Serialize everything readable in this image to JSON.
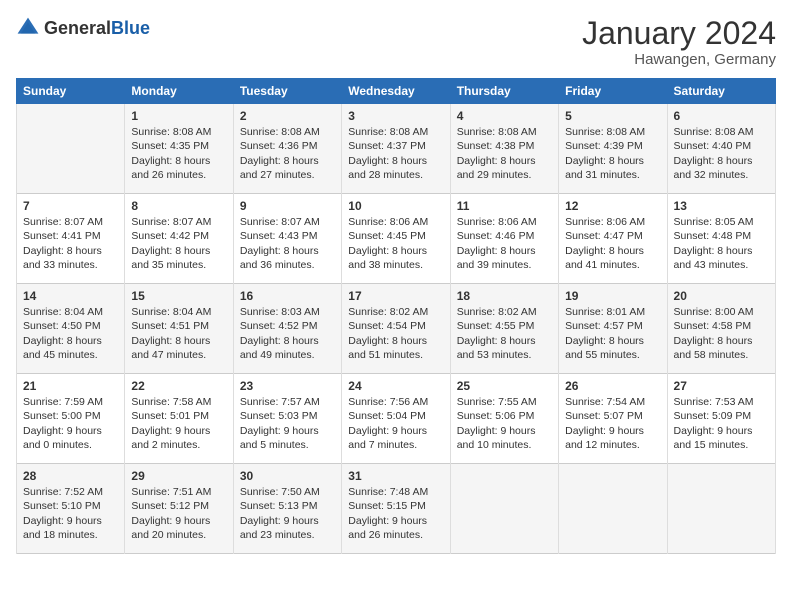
{
  "header": {
    "logo_general": "General",
    "logo_blue": "Blue",
    "month_title": "January 2024",
    "location": "Hawangen, Germany"
  },
  "weekdays": [
    "Sunday",
    "Monday",
    "Tuesday",
    "Wednesday",
    "Thursday",
    "Friday",
    "Saturday"
  ],
  "weeks": [
    [
      {
        "day": "",
        "lines": []
      },
      {
        "day": "1",
        "lines": [
          "Sunrise: 8:08 AM",
          "Sunset: 4:35 PM",
          "Daylight: 8 hours",
          "and 26 minutes."
        ]
      },
      {
        "day": "2",
        "lines": [
          "Sunrise: 8:08 AM",
          "Sunset: 4:36 PM",
          "Daylight: 8 hours",
          "and 27 minutes."
        ]
      },
      {
        "day": "3",
        "lines": [
          "Sunrise: 8:08 AM",
          "Sunset: 4:37 PM",
          "Daylight: 8 hours",
          "and 28 minutes."
        ]
      },
      {
        "day": "4",
        "lines": [
          "Sunrise: 8:08 AM",
          "Sunset: 4:38 PM",
          "Daylight: 8 hours",
          "and 29 minutes."
        ]
      },
      {
        "day": "5",
        "lines": [
          "Sunrise: 8:08 AM",
          "Sunset: 4:39 PM",
          "Daylight: 8 hours",
          "and 31 minutes."
        ]
      },
      {
        "day": "6",
        "lines": [
          "Sunrise: 8:08 AM",
          "Sunset: 4:40 PM",
          "Daylight: 8 hours",
          "and 32 minutes."
        ]
      }
    ],
    [
      {
        "day": "7",
        "lines": [
          "Sunrise: 8:07 AM",
          "Sunset: 4:41 PM",
          "Daylight: 8 hours",
          "and 33 minutes."
        ]
      },
      {
        "day": "8",
        "lines": [
          "Sunrise: 8:07 AM",
          "Sunset: 4:42 PM",
          "Daylight: 8 hours",
          "and 35 minutes."
        ]
      },
      {
        "day": "9",
        "lines": [
          "Sunrise: 8:07 AM",
          "Sunset: 4:43 PM",
          "Daylight: 8 hours",
          "and 36 minutes."
        ]
      },
      {
        "day": "10",
        "lines": [
          "Sunrise: 8:06 AM",
          "Sunset: 4:45 PM",
          "Daylight: 8 hours",
          "and 38 minutes."
        ]
      },
      {
        "day": "11",
        "lines": [
          "Sunrise: 8:06 AM",
          "Sunset: 4:46 PM",
          "Daylight: 8 hours",
          "and 39 minutes."
        ]
      },
      {
        "day": "12",
        "lines": [
          "Sunrise: 8:06 AM",
          "Sunset: 4:47 PM",
          "Daylight: 8 hours",
          "and 41 minutes."
        ]
      },
      {
        "day": "13",
        "lines": [
          "Sunrise: 8:05 AM",
          "Sunset: 4:48 PM",
          "Daylight: 8 hours",
          "and 43 minutes."
        ]
      }
    ],
    [
      {
        "day": "14",
        "lines": [
          "Sunrise: 8:04 AM",
          "Sunset: 4:50 PM",
          "Daylight: 8 hours",
          "and 45 minutes."
        ]
      },
      {
        "day": "15",
        "lines": [
          "Sunrise: 8:04 AM",
          "Sunset: 4:51 PM",
          "Daylight: 8 hours",
          "and 47 minutes."
        ]
      },
      {
        "day": "16",
        "lines": [
          "Sunrise: 8:03 AM",
          "Sunset: 4:52 PM",
          "Daylight: 8 hours",
          "and 49 minutes."
        ]
      },
      {
        "day": "17",
        "lines": [
          "Sunrise: 8:02 AM",
          "Sunset: 4:54 PM",
          "Daylight: 8 hours",
          "and 51 minutes."
        ]
      },
      {
        "day": "18",
        "lines": [
          "Sunrise: 8:02 AM",
          "Sunset: 4:55 PM",
          "Daylight: 8 hours",
          "and 53 minutes."
        ]
      },
      {
        "day": "19",
        "lines": [
          "Sunrise: 8:01 AM",
          "Sunset: 4:57 PM",
          "Daylight: 8 hours",
          "and 55 minutes."
        ]
      },
      {
        "day": "20",
        "lines": [
          "Sunrise: 8:00 AM",
          "Sunset: 4:58 PM",
          "Daylight: 8 hours",
          "and 58 minutes."
        ]
      }
    ],
    [
      {
        "day": "21",
        "lines": [
          "Sunrise: 7:59 AM",
          "Sunset: 5:00 PM",
          "Daylight: 9 hours",
          "and 0 minutes."
        ]
      },
      {
        "day": "22",
        "lines": [
          "Sunrise: 7:58 AM",
          "Sunset: 5:01 PM",
          "Daylight: 9 hours",
          "and 2 minutes."
        ]
      },
      {
        "day": "23",
        "lines": [
          "Sunrise: 7:57 AM",
          "Sunset: 5:03 PM",
          "Daylight: 9 hours",
          "and 5 minutes."
        ]
      },
      {
        "day": "24",
        "lines": [
          "Sunrise: 7:56 AM",
          "Sunset: 5:04 PM",
          "Daylight: 9 hours",
          "and 7 minutes."
        ]
      },
      {
        "day": "25",
        "lines": [
          "Sunrise: 7:55 AM",
          "Sunset: 5:06 PM",
          "Daylight: 9 hours",
          "and 10 minutes."
        ]
      },
      {
        "day": "26",
        "lines": [
          "Sunrise: 7:54 AM",
          "Sunset: 5:07 PM",
          "Daylight: 9 hours",
          "and 12 minutes."
        ]
      },
      {
        "day": "27",
        "lines": [
          "Sunrise: 7:53 AM",
          "Sunset: 5:09 PM",
          "Daylight: 9 hours",
          "and 15 minutes."
        ]
      }
    ],
    [
      {
        "day": "28",
        "lines": [
          "Sunrise: 7:52 AM",
          "Sunset: 5:10 PM",
          "Daylight: 9 hours",
          "and 18 minutes."
        ]
      },
      {
        "day": "29",
        "lines": [
          "Sunrise: 7:51 AM",
          "Sunset: 5:12 PM",
          "Daylight: 9 hours",
          "and 20 minutes."
        ]
      },
      {
        "day": "30",
        "lines": [
          "Sunrise: 7:50 AM",
          "Sunset: 5:13 PM",
          "Daylight: 9 hours",
          "and 23 minutes."
        ]
      },
      {
        "day": "31",
        "lines": [
          "Sunrise: 7:48 AM",
          "Sunset: 5:15 PM",
          "Daylight: 9 hours",
          "and 26 minutes."
        ]
      },
      {
        "day": "",
        "lines": []
      },
      {
        "day": "",
        "lines": []
      },
      {
        "day": "",
        "lines": []
      }
    ]
  ]
}
